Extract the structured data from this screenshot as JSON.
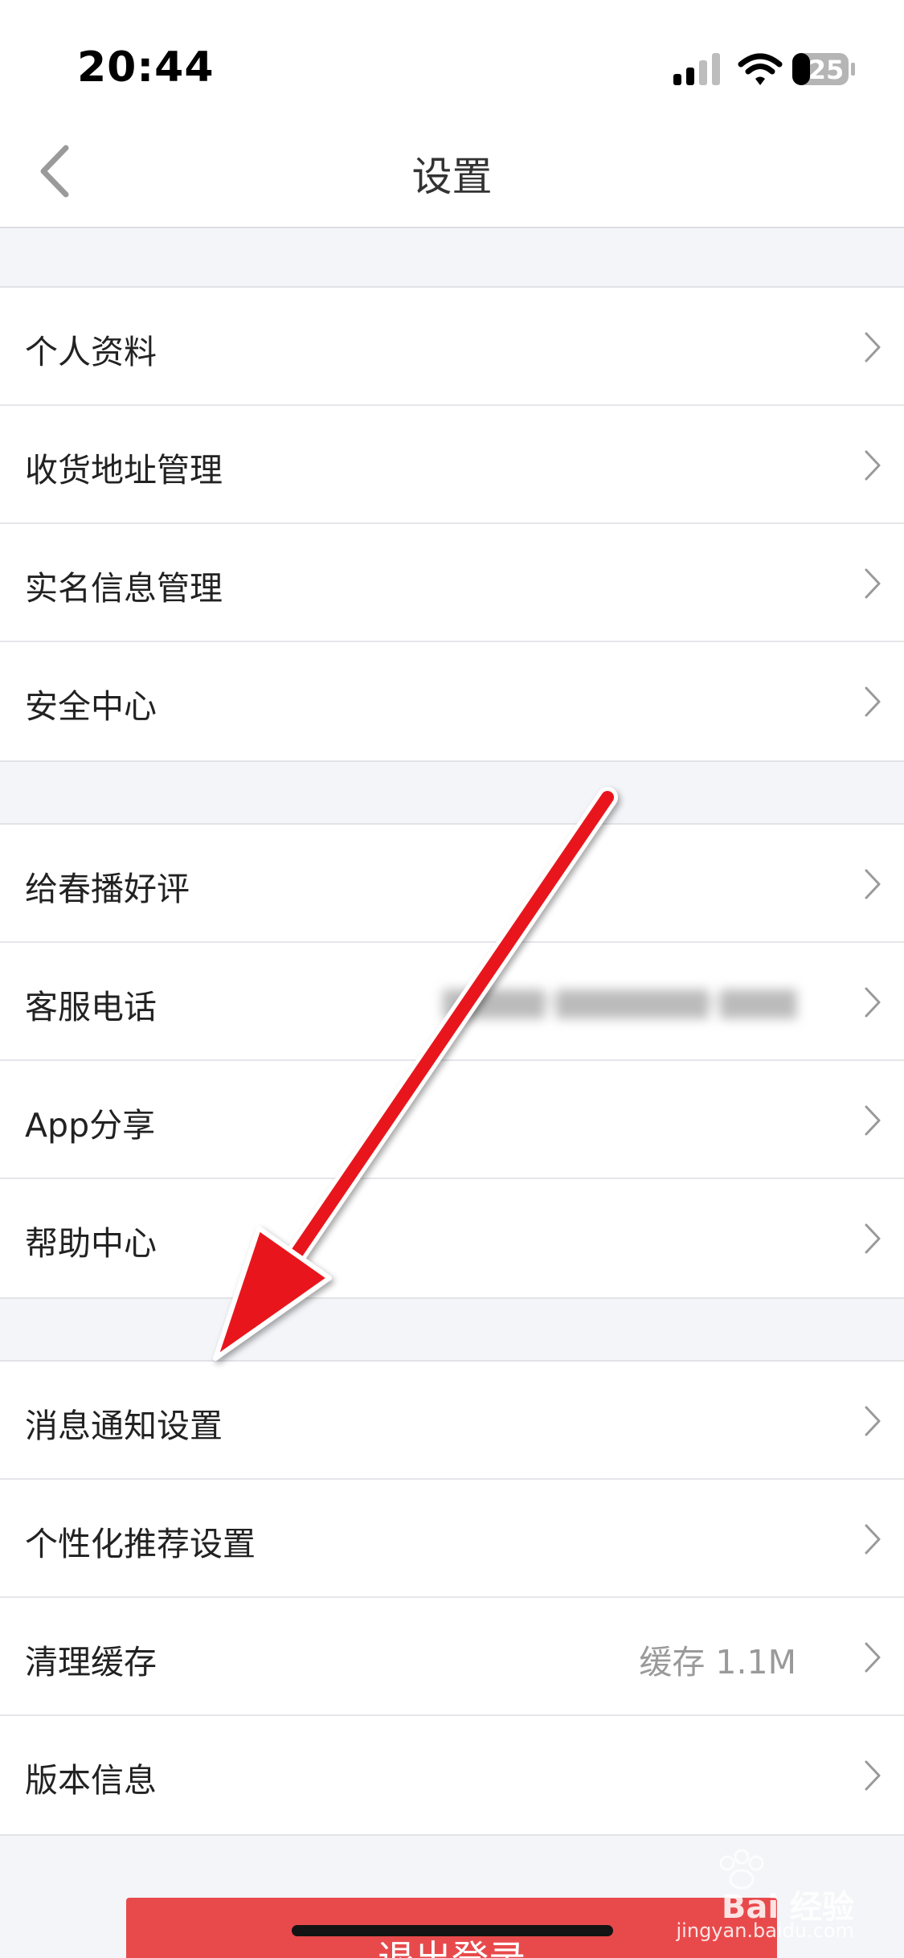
{
  "status_bar": {
    "time": "20:44",
    "battery": "25",
    "icons": [
      "signal-icon",
      "wifi-icon",
      "battery-icon"
    ]
  },
  "nav": {
    "title": "设置",
    "back_icon": "chevron-left-icon"
  },
  "groups": [
    {
      "items": [
        {
          "label": "个人资料"
        },
        {
          "label": "收货地址管理"
        },
        {
          "label": "实名信息管理"
        },
        {
          "label": "安全中心"
        }
      ]
    },
    {
      "items": [
        {
          "label": "给春播好评"
        },
        {
          "label": "客服电话"
        },
        {
          "label": "App分享"
        },
        {
          "label": "帮助中心"
        }
      ]
    },
    {
      "items": [
        {
          "label": "消息通知设置"
        },
        {
          "label": "个性化推荐设置"
        },
        {
          "label": "清理缓存",
          "value": "缓存 1.1M"
        },
        {
          "label": "版本信息"
        }
      ]
    }
  ],
  "logout_label": "退出登录",
  "watermark": {
    "text": "Bai 经验",
    "sub": "jingyan.baidu.com"
  },
  "colors": {
    "logout": "#e84a4c",
    "annotation_arrow": "#e8131a",
    "background": "#f4f5f9"
  }
}
